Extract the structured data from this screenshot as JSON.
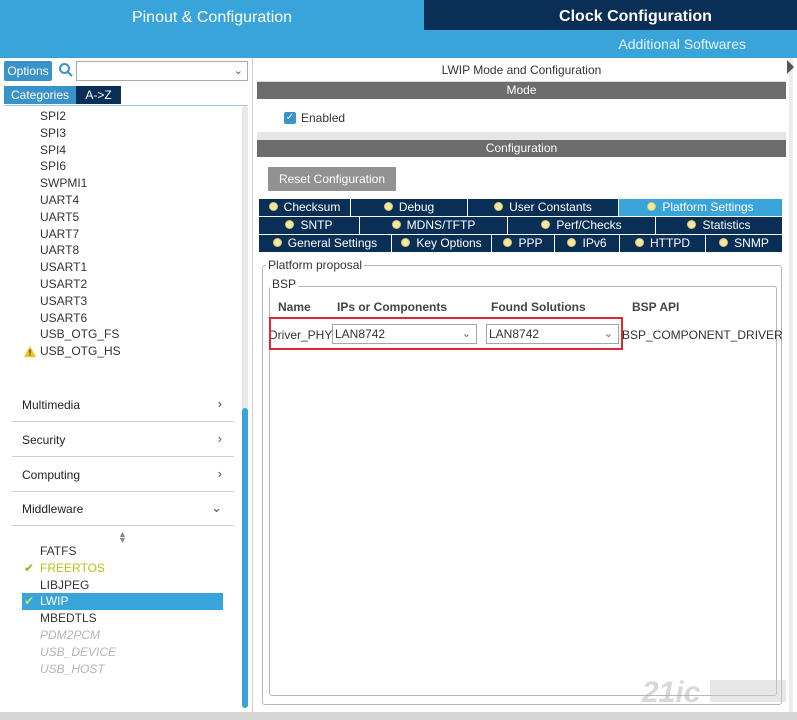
{
  "header": {
    "tab_pinout": "Pinout & Configuration",
    "tab_clock": "Clock Configuration",
    "additional": "Additional Softwares"
  },
  "left": {
    "options_label": "Options",
    "search_value": "",
    "categories_label": "Categories",
    "az_label": "A->Z",
    "connectivity_items": [
      {
        "label": "SPI2",
        "warn": false
      },
      {
        "label": "SPI3",
        "warn": false
      },
      {
        "label": "SPI4",
        "warn": false
      },
      {
        "label": "SPI6",
        "warn": false
      },
      {
        "label": "SWPMI1",
        "warn": false
      },
      {
        "label": "UART4",
        "warn": false
      },
      {
        "label": "UART5",
        "warn": false
      },
      {
        "label": "UART7",
        "warn": false
      },
      {
        "label": "UART8",
        "warn": false
      },
      {
        "label": "USART1",
        "warn": false
      },
      {
        "label": "USART2",
        "warn": false
      },
      {
        "label": "USART3",
        "warn": false
      },
      {
        "label": "USART6",
        "warn": false
      },
      {
        "label": "USB_OTG_FS",
        "warn": false
      },
      {
        "label": "USB_OTG_HS",
        "warn": true
      }
    ],
    "categories": [
      "Multimedia",
      "Security",
      "Computing",
      "Middleware"
    ],
    "middleware_items": [
      {
        "label": "FATFS",
        "state": "normal"
      },
      {
        "label": "FREERTOS",
        "state": "checked"
      },
      {
        "label": "LIBJPEG",
        "state": "normal"
      },
      {
        "label": "LWIP",
        "state": "selected"
      },
      {
        "label": "MBEDTLS",
        "state": "normal"
      },
      {
        "label": "PDM2PCM",
        "state": "disabled"
      },
      {
        "label": "USB_DEVICE",
        "state": "disabled"
      },
      {
        "label": "USB_HOST",
        "state": "disabled"
      }
    ]
  },
  "right": {
    "title": "LWIP Mode and Configuration",
    "mode_header": "Mode",
    "enabled_label": "Enabled",
    "enabled_checked": true,
    "config_header": "Configuration",
    "reset_label": "Reset Configuration",
    "tabs": [
      [
        "Checksum",
        "Debug",
        "User Constants",
        "Platform Settings"
      ],
      [
        "SNTP",
        "MDNS/TFTP",
        "Perf/Checks",
        "Statistics"
      ],
      [
        "General Settings",
        "Key Options",
        "PPP",
        "IPv6",
        "HTTPD",
        "SNMP"
      ]
    ],
    "active_tab": "Platform Settings",
    "platform_proposal": "Platform proposal",
    "bsp_label": "BSP",
    "columns": [
      "Name",
      "IPs or Components",
      "Found Solutions",
      "BSP API"
    ],
    "row": {
      "name": "Driver_PHY",
      "ip": "LAN8742",
      "solution": "LAN8742",
      "api": "BSP_COMPONENT_DRIVER"
    }
  },
  "colors": {
    "accent_light": "#39a4d9",
    "accent_dark": "#0a2f57",
    "highlight": "#e0262e"
  }
}
